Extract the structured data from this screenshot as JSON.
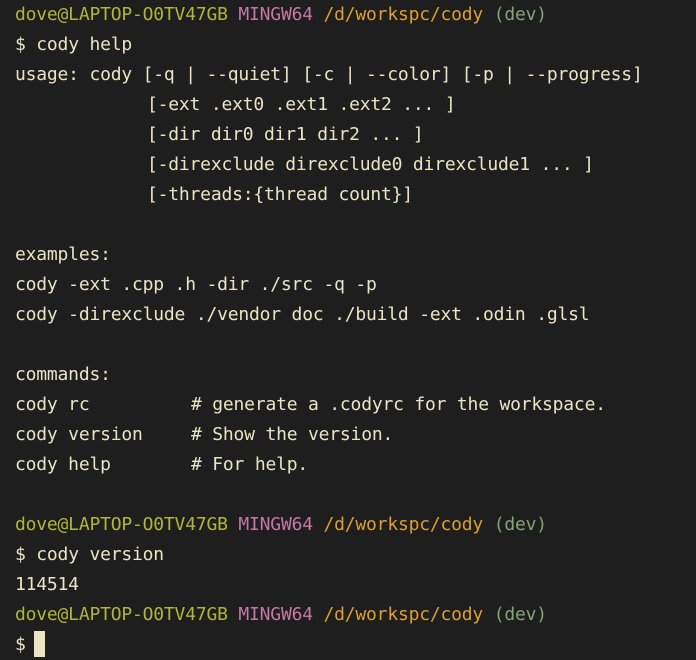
{
  "prompt": {
    "user": "dove@LAPTOP-O0TV47GB",
    "system": "MINGW64",
    "path": "/d/workspc/cody",
    "branch": "(dev)",
    "symbol": "$"
  },
  "session": {
    "cmd1": "cody help",
    "usage": {
      "line1": "usage: cody [-q | --quiet] [-c | --color] [-p | --progress]",
      "line2": "[-ext .ext0 .ext1 .ext2 ... ]",
      "line3": "[-dir dir0 dir1 dir2 ... ]",
      "line4": "[-direxclude direxclude0 direxclude1 ... ]",
      "line5": "[-threads:{thread count}]"
    },
    "examples": {
      "header": "examples:",
      "ex1": "cody -ext .cpp .h -dir ./src -q -p",
      "ex2": "cody -direxclude ./vendor doc ./build -ext .odin .glsl"
    },
    "commands": {
      "header": "commands:",
      "items": [
        {
          "name": "cody rc",
          "desc": "# generate a .codyrc for the workspace."
        },
        {
          "name": "cody version",
          "desc": "# Show the version."
        },
        {
          "name": "cody help",
          "desc": "# For help."
        }
      ]
    },
    "cmd2": "cody version",
    "version_output": "114514"
  },
  "colors": {
    "background": "#1e1e1e",
    "text": "#eae4c3",
    "user": "#b1b53a",
    "system": "#c678a5",
    "path": "#dd9f2e",
    "branch": "#84a572"
  }
}
